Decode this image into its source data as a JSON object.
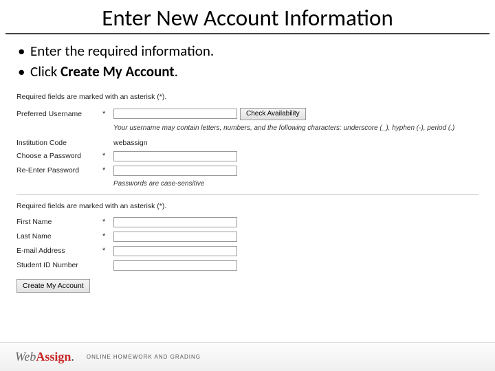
{
  "title": "Enter New Account Information",
  "bullets": {
    "b1": "Enter the required information.",
    "b2_pre": "Click ",
    "b2_bold": "Create My Account",
    "b2_post": "."
  },
  "form": {
    "note1": "Required fields are marked with an asterisk (*).",
    "username": {
      "label": "Preferred Username",
      "req": "*",
      "check_label": "Check Availability",
      "helper": "Your username may contain letters, numbers, and the following characters: underscore (_), hyphen (-), period (.)"
    },
    "inst": {
      "label": "Institution Code",
      "value": "webassign"
    },
    "pwd": {
      "label": "Choose a Password",
      "req": "*"
    },
    "pwd2": {
      "label": "Re-Enter Password",
      "req": "*",
      "helper": "Passwords are case-sensitive"
    },
    "note2": "Required fields are marked with an asterisk (*).",
    "first": {
      "label": "First Name",
      "req": "*"
    },
    "last": {
      "label": "Last Name",
      "req": "*"
    },
    "email": {
      "label": "E-mail Address",
      "req": "*"
    },
    "sid": {
      "label": "Student ID Number"
    },
    "create_label": "Create My Account"
  },
  "footer": {
    "brand_web": "Web",
    "brand_assign": "Assign",
    "brand_dot": ".",
    "tagline": "ONLINE HOMEWORK AND GRADING"
  }
}
